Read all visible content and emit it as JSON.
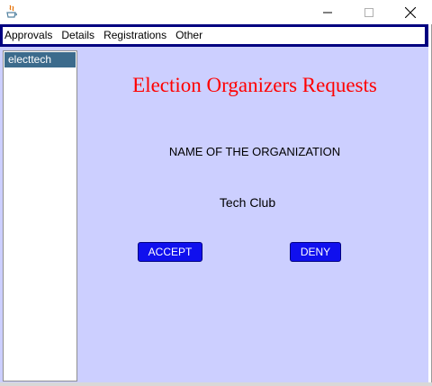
{
  "window": {
    "menu": [
      "Approvals",
      "Details",
      "Registrations",
      "Other"
    ]
  },
  "sidebar": {
    "items": [
      "electtech"
    ]
  },
  "main": {
    "heading": "Election Organizers Requests",
    "org_label": "NAME OF THE ORGANIZATION",
    "org_value": "Tech Club",
    "accept_label": "ACCEPT",
    "deny_label": "DENY"
  },
  "colors": {
    "content_bg": "#cccfff",
    "menubar_border": "#000080",
    "heading": "#ff0000",
    "button": "#1010ee",
    "selection": "#3c6b8c"
  },
  "icons": [
    "java-app-icon",
    "minimize-icon",
    "maximize-icon",
    "close-icon"
  ]
}
